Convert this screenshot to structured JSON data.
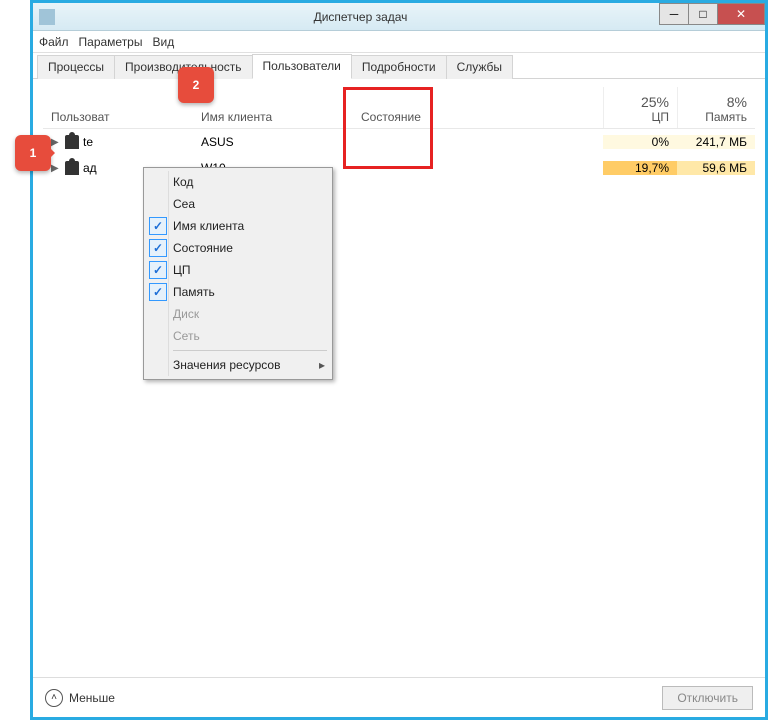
{
  "window": {
    "title": "Диспетчер задач"
  },
  "menu": {
    "file": "Файл",
    "options": "Параметры",
    "view": "Вид"
  },
  "tabs": {
    "processes": "Процессы",
    "performance": "Производительность",
    "users": "Пользователи",
    "details": "Подробности",
    "services": "Службы"
  },
  "headers": {
    "user": "Пользоват",
    "client": "Имя клиента",
    "state": "Состояние",
    "cpu_pct": "25%",
    "cpu": "ЦП",
    "mem_pct": "8%",
    "mem": "Память"
  },
  "rows": [
    {
      "user": "te",
      "client": "ASUS",
      "state": "",
      "cpu": "0%",
      "mem": "241,7 МБ",
      "cpu_class": "low",
      "mem_class": "low"
    },
    {
      "user": "ад",
      "client": "W10",
      "state": "",
      "cpu": "19,7%",
      "mem": "59,6 МБ",
      "cpu_class": "mid",
      "mem_class": "mid"
    }
  ],
  "context": {
    "kod": "Код",
    "seance": "Сеа",
    "client": "Имя клиента",
    "state": "Состояние",
    "cpu": "ЦП",
    "mem": "Память",
    "disk": "Диск",
    "net": "Сеть",
    "resources": "Значения ресурсов"
  },
  "footer": {
    "less": "Меньше",
    "disconnect": "Отключить"
  },
  "callouts": {
    "one": "1",
    "two": "2"
  }
}
